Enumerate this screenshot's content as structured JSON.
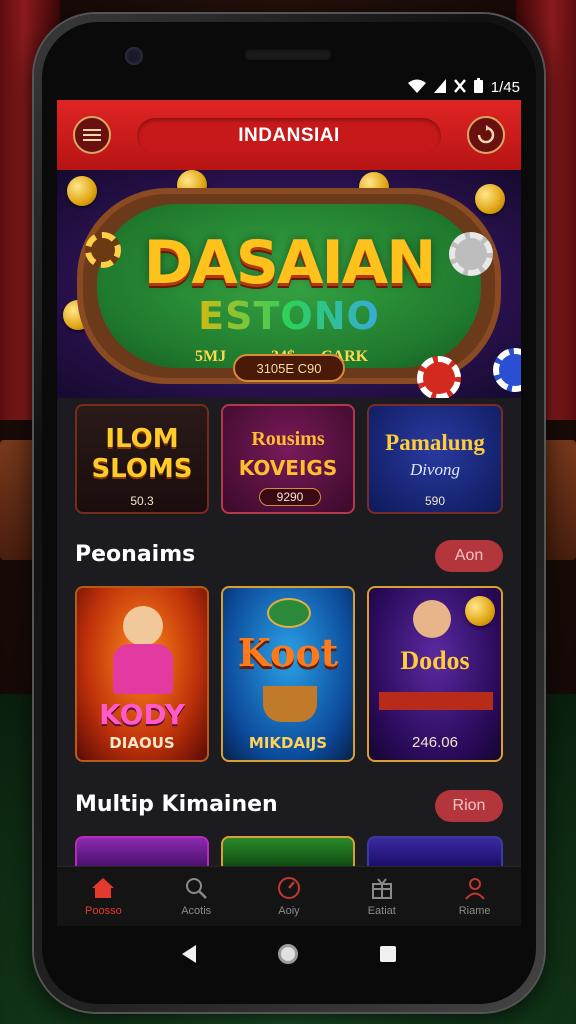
{
  "status_bar": {
    "time": "1/45"
  },
  "header": {
    "title": "INDANSIAI"
  },
  "hero": {
    "title": "DASAIAN",
    "subtitle": "ESTONO",
    "line_left": "5MJ",
    "line_mid": "34$",
    "line_right": "CARK",
    "badge": "3105E C90"
  },
  "top_games": [
    {
      "title_top": "ILOM",
      "title_bottom": "SLOMS",
      "value": "50.3"
    },
    {
      "title_top": "Rousims",
      "title_bottom": "KOVEIGS",
      "value": "9290"
    },
    {
      "title_top": "Pamalung",
      "title_bottom": "Divong",
      "value": "590"
    }
  ],
  "sections": [
    {
      "title": "Peonaims",
      "button": "Aon"
    },
    {
      "title": "Multip Kimainen",
      "button": "Rion"
    }
  ],
  "featured_games": [
    {
      "title": "KODY",
      "label": "DIAOUS"
    },
    {
      "title": "Koot",
      "label": "MIKDAIJS"
    },
    {
      "title": "Dodos",
      "label": "246.06"
    }
  ],
  "bottom_nav": [
    {
      "label": "Poosso",
      "icon": "home-icon"
    },
    {
      "label": "Acotis",
      "icon": "search-icon"
    },
    {
      "label": "Aoiy",
      "icon": "gauge-icon"
    },
    {
      "label": "Eatiat",
      "icon": "gift-box-icon"
    },
    {
      "label": "Riame",
      "icon": "user-icon"
    }
  ],
  "colors": {
    "accent": "#e02424",
    "active_nav": "#e33a2d",
    "section_button": "#b3363c"
  }
}
